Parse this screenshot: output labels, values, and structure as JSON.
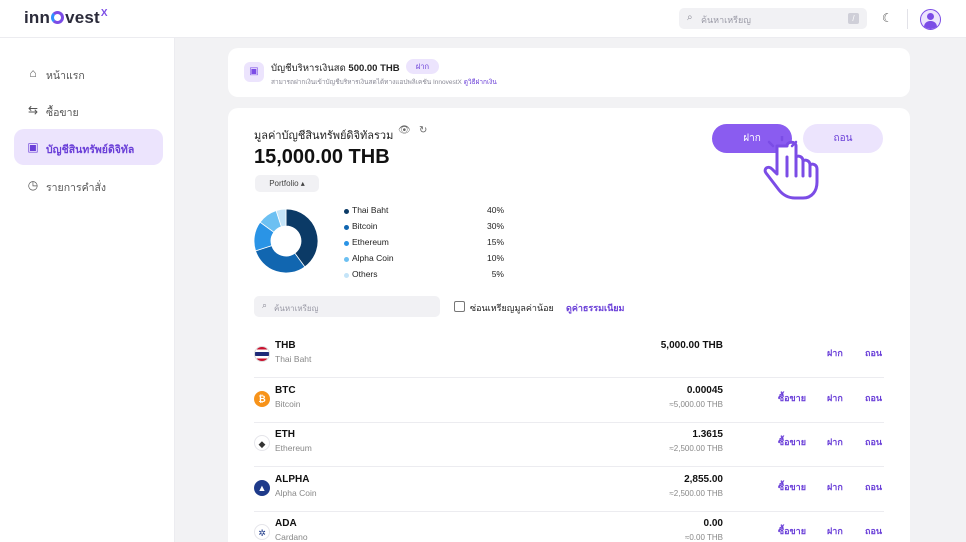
{
  "header": {
    "logo_text": "innovest",
    "logo_super": "X",
    "search_placeholder": "ค้นหาเหรียญ",
    "search_shortcut": "/",
    "theme_icon": "moon-icon",
    "avatar_icon": "user-icon"
  },
  "sidebar": {
    "items": [
      {
        "label": "หน้าแรก",
        "icon": "home-icon",
        "active": false
      },
      {
        "label": "ซื้อขาย",
        "icon": "swap-icon",
        "active": false
      },
      {
        "label": "บัญชีสินทรัพย์ดิจิทัล",
        "icon": "wallet-icon",
        "active": true
      },
      {
        "label": "รายการคำสั่ง",
        "icon": "clock-icon",
        "active": false
      }
    ]
  },
  "cash_account": {
    "title_prefix": "บัญชีบริหารเงินสด",
    "amount": "500.00 THB",
    "deposit_label": "ฝาก",
    "subtitle": "สามารถฝากเงินเข้าบัญชีบริหารเงินสดได้ทางแอปพลิเคชัน InnovestX",
    "how_to_link": "ดูวิธีฝากเงิน"
  },
  "portfolio": {
    "label": "มูลค่าบัญชีสินทรัพย์ดิจิทัลรวม",
    "value": "15,000.00 THB",
    "view_selector": "Portfolio ▴",
    "deposit_button": "ฝาก",
    "withdraw_button": "ถอน"
  },
  "chart_data": {
    "type": "pie",
    "donut": true,
    "categories": [
      "Thai Baht",
      "Bitcoin",
      "Ethereum",
      "Alpha Coin",
      "Others"
    ],
    "values": [
      40,
      30,
      15,
      10,
      5
    ],
    "labels": [
      "40%",
      "30%",
      "15%",
      "10%",
      "5%"
    ],
    "colors": [
      "#0b3a66",
      "#1166b0",
      "#2a94e6",
      "#6cc0f2",
      "#c4e4f8"
    ],
    "legend_position": "right"
  },
  "filters": {
    "search_placeholder": "ค้นหาเหรียญ",
    "hide_small_label": "ซ่อนเหรียญมูลค่าน้อย",
    "fees_link": "ดูค่าธรรมเนียม"
  },
  "actions": {
    "trade": "ซื้อขาย",
    "deposit": "ฝาก",
    "withdraw": "ถอน"
  },
  "assets": [
    {
      "symbol": "THB",
      "name": "Thai Baht",
      "amount": "5,000.00 THB",
      "thb_value": "",
      "icon": "thai-flag-icon",
      "color": "#ffffff",
      "tradable": false
    },
    {
      "symbol": "BTC",
      "name": "Bitcoin",
      "amount": "0.00045",
      "thb_value": "≈5,000.00 THB",
      "icon": "bitcoin-icon",
      "color": "#f7931a",
      "tradable": true
    },
    {
      "symbol": "ETH",
      "name": "Ethereum",
      "amount": "1.3615",
      "thb_value": "≈2,500.00 THB",
      "icon": "ethereum-icon",
      "color": "#ffffff",
      "tradable": true
    },
    {
      "symbol": "ALPHA",
      "name": "Alpha Coin",
      "amount": "2,855.00",
      "thb_value": "≈2,500.00 THB",
      "icon": "alpha-icon",
      "color": "#1e3a8a",
      "tradable": true
    },
    {
      "symbol": "ADA",
      "name": "Cardano",
      "amount": "0.00",
      "thb_value": "≈0.00 THB",
      "icon": "cardano-icon",
      "color": "#ffffff",
      "tradable": true
    }
  ]
}
